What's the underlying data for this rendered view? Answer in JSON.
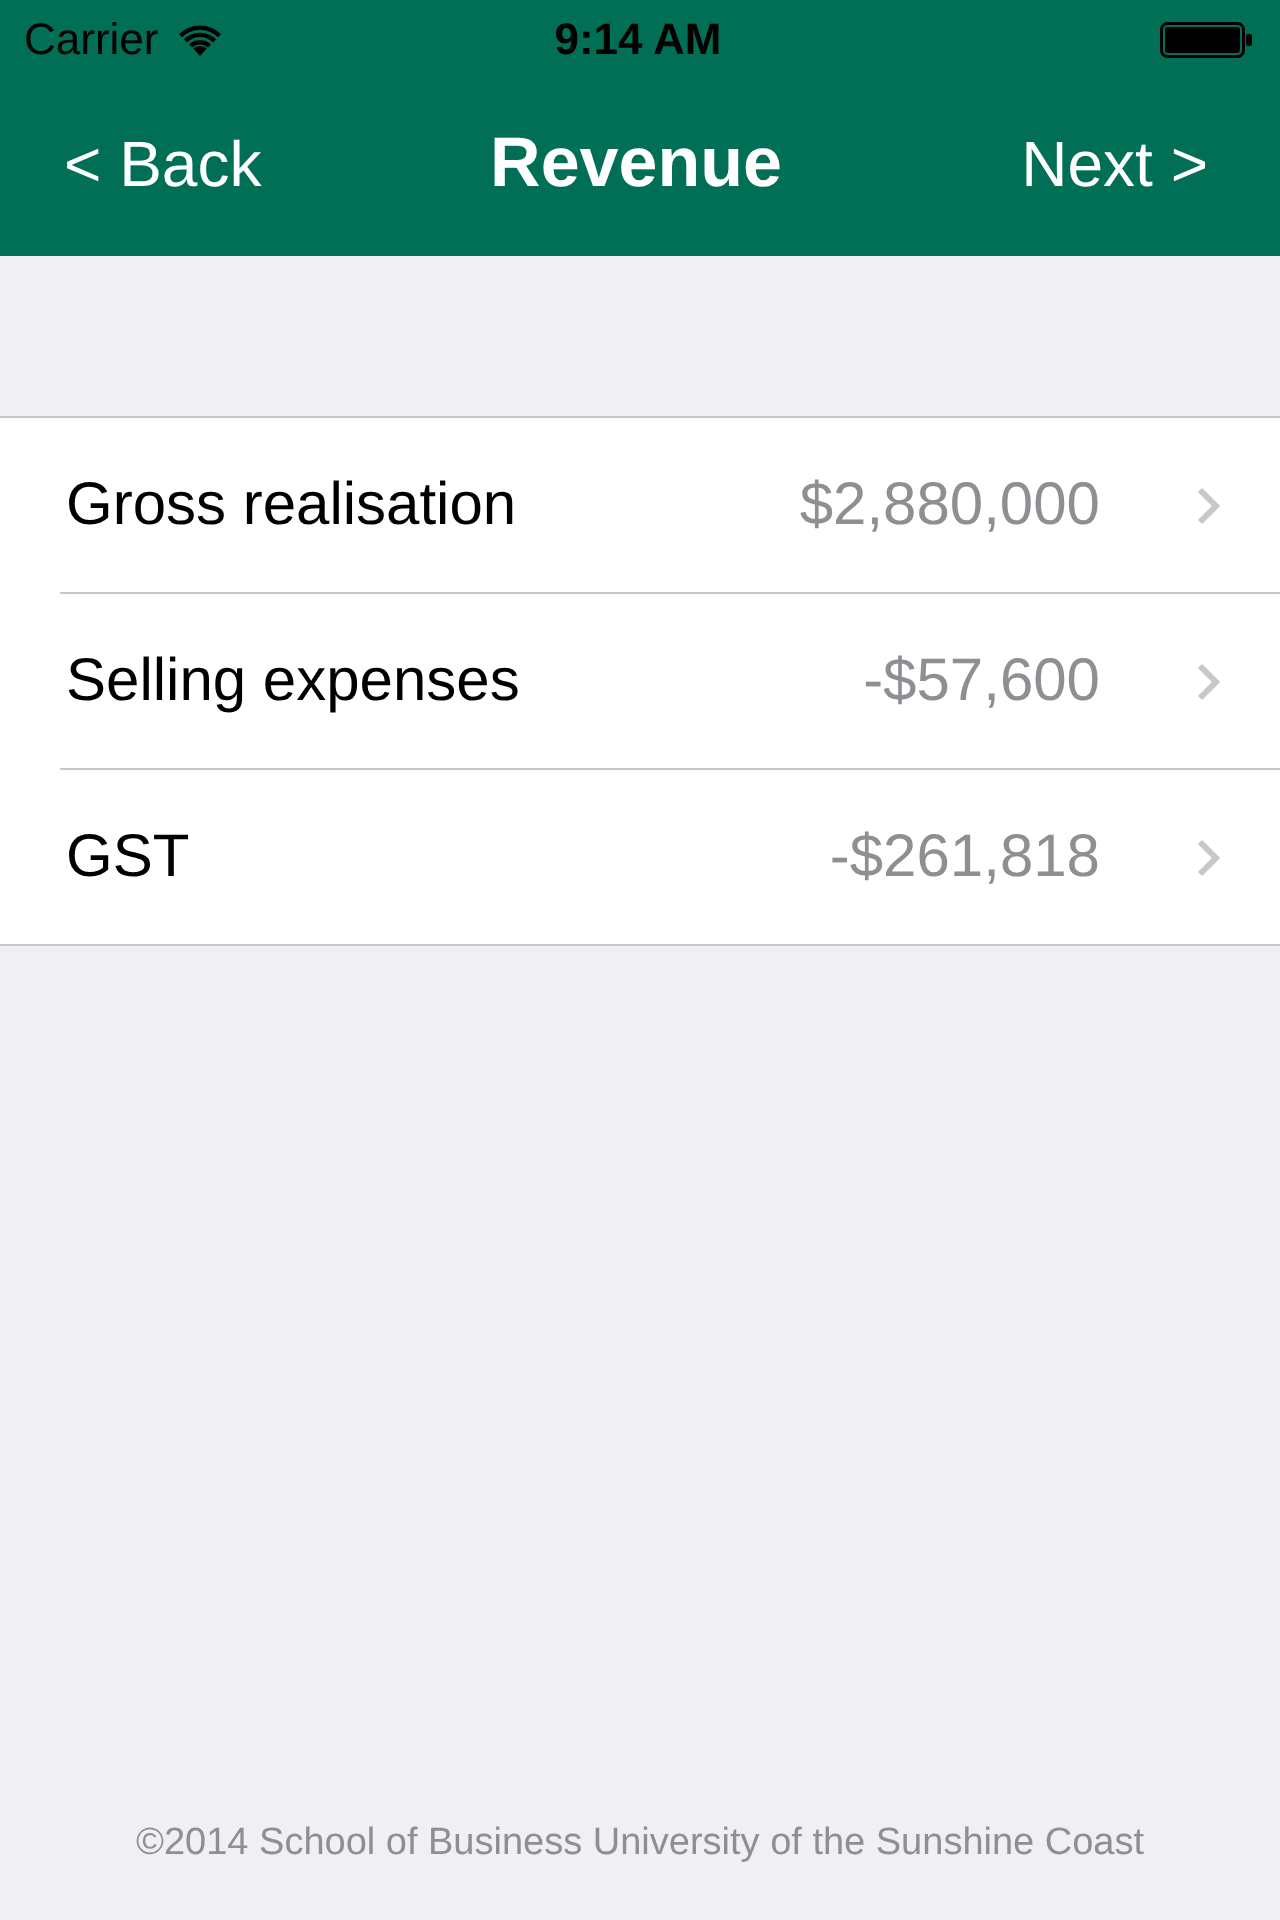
{
  "status_bar": {
    "carrier": "Carrier",
    "time": "9:14 AM"
  },
  "nav_bar": {
    "back": "< Back",
    "title": "Revenue",
    "next": "Next >"
  },
  "rows": [
    {
      "label": "Gross realisation",
      "value": "$2,880,000"
    },
    {
      "label": "Selling expenses",
      "value": "-$57,600"
    },
    {
      "label": "GST",
      "value": "-$261,818"
    }
  ],
  "footer": "©2014 School of Business University of the Sunshine Coast"
}
